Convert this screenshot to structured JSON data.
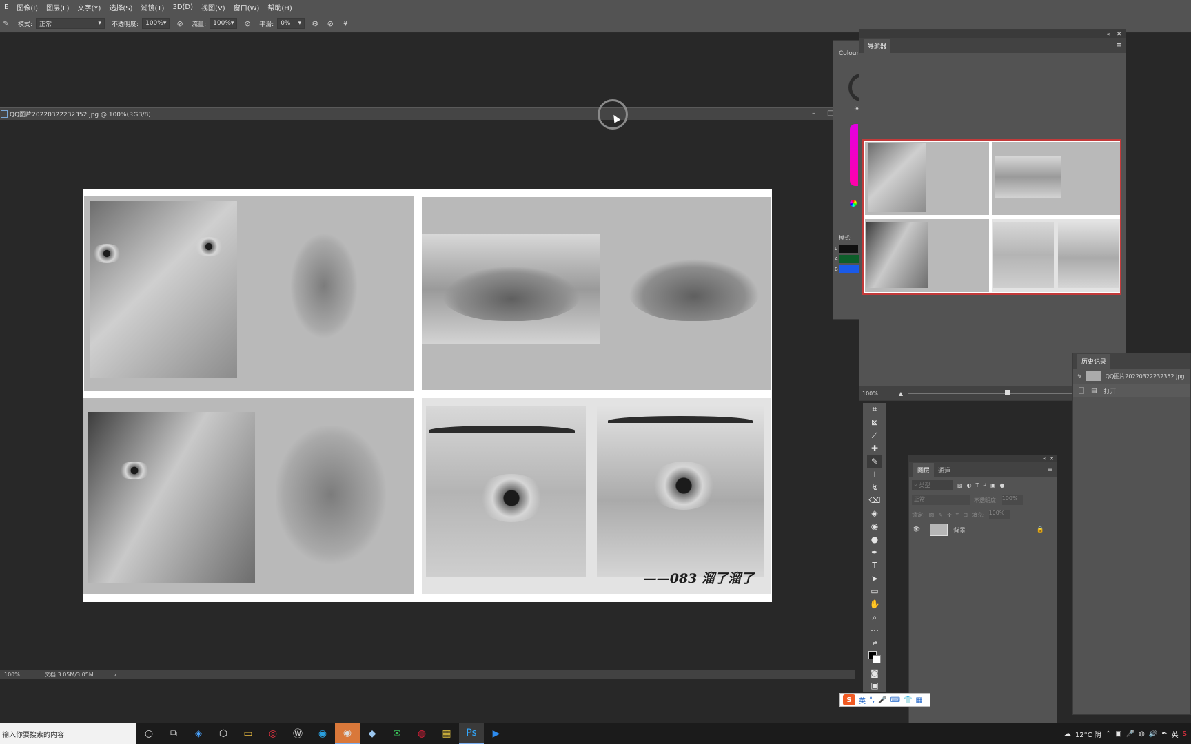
{
  "menu": [
    "E",
    "图像(I)",
    "图层(L)",
    "文字(Y)",
    "选择(S)",
    "滤镜(T)",
    "3D(D)",
    "视图(V)",
    "窗口(W)",
    "帮助(H)"
  ],
  "options": {
    "mode_label": "模式:",
    "mode_value": "正常",
    "opacity_label": "不透明度:",
    "opacity_value": "100%",
    "flow_label": "流量:",
    "flow_value": "100%",
    "smooth_label": "平滑:",
    "smooth_value": "0%"
  },
  "document": {
    "tab_title": "QQ图片20220322232352.jpg @ 100%(RGB/8)",
    "signature": "——083 溜了溜了"
  },
  "statusbar": {
    "zoom": "100%",
    "doc_info": "文档:3.05M/3.05M"
  },
  "navigator": {
    "title": "导航器",
    "zoom": "100%"
  },
  "colour_panel": {
    "title": "Colour",
    "mode_label": "模式:",
    "channels": [
      "L",
      "A",
      "B"
    ],
    "channel_colors": [
      "#101010",
      "#0d5e2a",
      "#1a5ae8"
    ]
  },
  "history": {
    "title": "历史记录",
    "snapshot": "QQ图片20220322232352.jpg",
    "step": "打开"
  },
  "layers": {
    "tab_layers": "图层",
    "tab_channels": "通道",
    "search_placeholder": "类型",
    "blend_mode": "正常",
    "opacity_label": "不透明度:",
    "opacity_value": "100%",
    "lock_label": "锁定:",
    "fill_label": "填充:",
    "fill_value": "100%",
    "layer_name": "背景"
  },
  "taskbar": {
    "search_placeholder": "输入你要搜索的内容",
    "weather": "12°C 阴",
    "lang": "英"
  },
  "ime": {
    "label": "英"
  }
}
